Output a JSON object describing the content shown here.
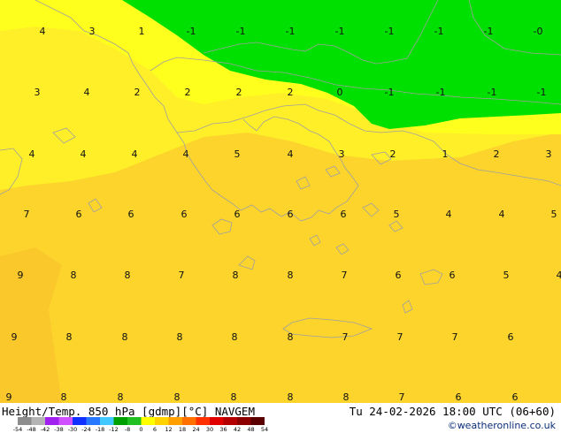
{
  "title": {
    "left": "Height/Temp. 850 hPa [gdmp][°C] NAVGEM",
    "right": "Tu 24-02-2026 18:00 UTC (06+60)"
  },
  "credit": "©weatheronline.co.uk",
  "colorbar": {
    "ticks": [
      "-54",
      "-48",
      "-42",
      "-38",
      "-30",
      "-24",
      "-18",
      "-12",
      "-8",
      "0",
      "6",
      "12",
      "18",
      "24",
      "30",
      "36",
      "42",
      "48",
      "54"
    ],
    "colors": [
      "#8c8c8c",
      "#b4b4b4",
      "#a020f0",
      "#d050ff",
      "#1030ff",
      "#2878ff",
      "#40c8ff",
      "#00a000",
      "#20c020",
      "#ffff00",
      "#ffd200",
      "#ffa000",
      "#ff7000",
      "#ff3000",
      "#e00000",
      "#b40000",
      "#8c0000",
      "#5a0000"
    ]
  },
  "fields": {
    "green": "#00e000",
    "yellow_light": "#ffff1e",
    "yellow_mid": "#ffef28",
    "yellow_dark": "#fcd42c",
    "orange_light": "#fbc82c",
    "coast": "#a0a0a0"
  },
  "values": {
    "r1": [
      "4",
      "3",
      "1",
      "-1",
      "-1",
      "-1",
      "-1",
      "-1",
      "-1",
      "-1",
      "-0"
    ],
    "r2": [
      "3",
      "4",
      "2",
      "2",
      "2",
      "2",
      "0",
      "-1",
      "-1",
      "-1",
      "-1"
    ],
    "r3": [
      "4",
      "4",
      "4",
      "4",
      "5",
      "4",
      "3",
      "2",
      "1",
      "2",
      "3"
    ],
    "r4": [
      "7",
      "6",
      "6",
      "6",
      "6",
      "6",
      "6",
      "5",
      "4",
      "4",
      "5"
    ],
    "r5": [
      "9",
      "8",
      "8",
      "7",
      "8",
      "8",
      "7",
      "6",
      "6",
      "5",
      "4"
    ],
    "r6": [
      "9",
      "8",
      "8",
      "8",
      "8",
      "8",
      "7",
      "7",
      "7",
      "6"
    ],
    "r7": [
      "9",
      "8",
      "8",
      "8",
      "8",
      "8",
      "8",
      "7",
      "6",
      "6"
    ]
  }
}
